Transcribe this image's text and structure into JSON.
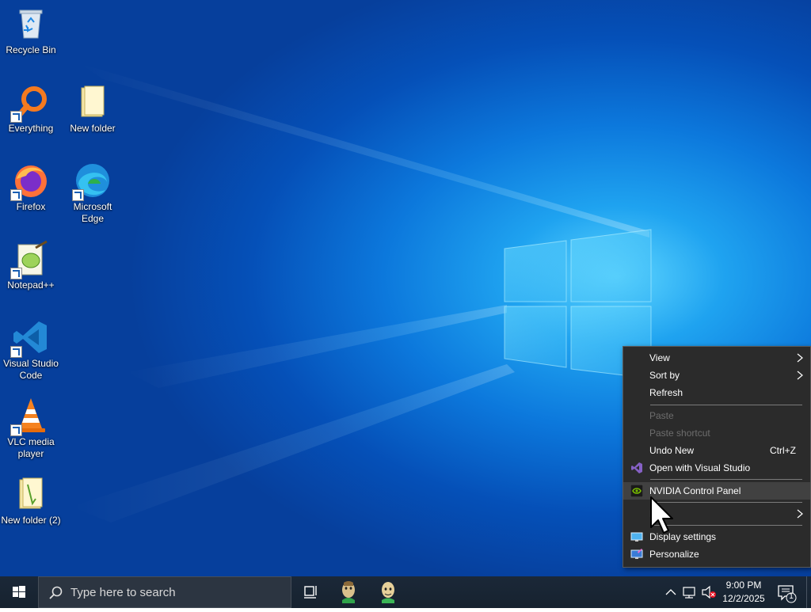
{
  "desktop": {
    "icons": [
      {
        "label": "Recycle Bin"
      },
      {
        "label": "Everything"
      },
      {
        "label": "New folder"
      },
      {
        "label": "Firefox"
      },
      {
        "label": "Microsoft Edge"
      },
      {
        "label": "Notepad++"
      },
      {
        "label": "Visual Studio Code"
      },
      {
        "label": "VLC media player"
      },
      {
        "label": "New folder (2)"
      }
    ]
  },
  "context_menu": {
    "items": [
      {
        "label": "View",
        "submenu": true
      },
      {
        "label": "Sort by",
        "submenu": true
      },
      {
        "label": "Refresh"
      },
      {
        "label": "Paste",
        "disabled": true
      },
      {
        "label": "Paste shortcut",
        "disabled": true
      },
      {
        "label": "Undo New",
        "shortcut": "Ctrl+Z"
      },
      {
        "label": "Open with Visual Studio",
        "icon": "visual-studio-icon"
      },
      {
        "label": "NVIDIA Control Panel",
        "icon": "nvidia-icon"
      },
      {
        "label": "N",
        "submenu": true
      },
      {
        "label": "Display settings",
        "icon": "display-icon"
      },
      {
        "label": "Personalize",
        "icon": "personalize-icon"
      }
    ]
  },
  "taskbar": {
    "search_placeholder": "Type here to search",
    "clock_time": "9:00 PM",
    "clock_date": "12/2/2025",
    "notification_count": "1"
  },
  "colors": {
    "menu_bg": "#2b2b2b",
    "menu_hover": "#414141",
    "taskbar_bg": "#1b2838",
    "accent": "#0078d7"
  }
}
